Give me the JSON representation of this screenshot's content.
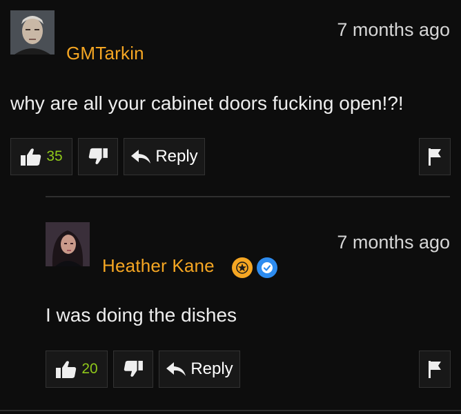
{
  "comments": [
    {
      "username": "GMTarkin",
      "timestamp": "7 months ago",
      "text": "why are all your cabinet doors fucking open!?!",
      "likes": "35",
      "reply_label": "Reply"
    },
    {
      "username": "Heather Kane",
      "timestamp": "7 months ago",
      "text": "I was doing the dishes",
      "likes": "20",
      "reply_label": "Reply",
      "badges": [
        "star-badge-icon",
        "verified-badge-icon"
      ]
    }
  ],
  "colors": {
    "background": "#0d0d0d",
    "username": "#f5a623",
    "like_count": "#8fc81a",
    "verified": "#2d8cf0"
  },
  "icons": [
    "thumbs-up-icon",
    "thumbs-down-icon",
    "reply-arrow-icon",
    "flag-icon"
  ]
}
